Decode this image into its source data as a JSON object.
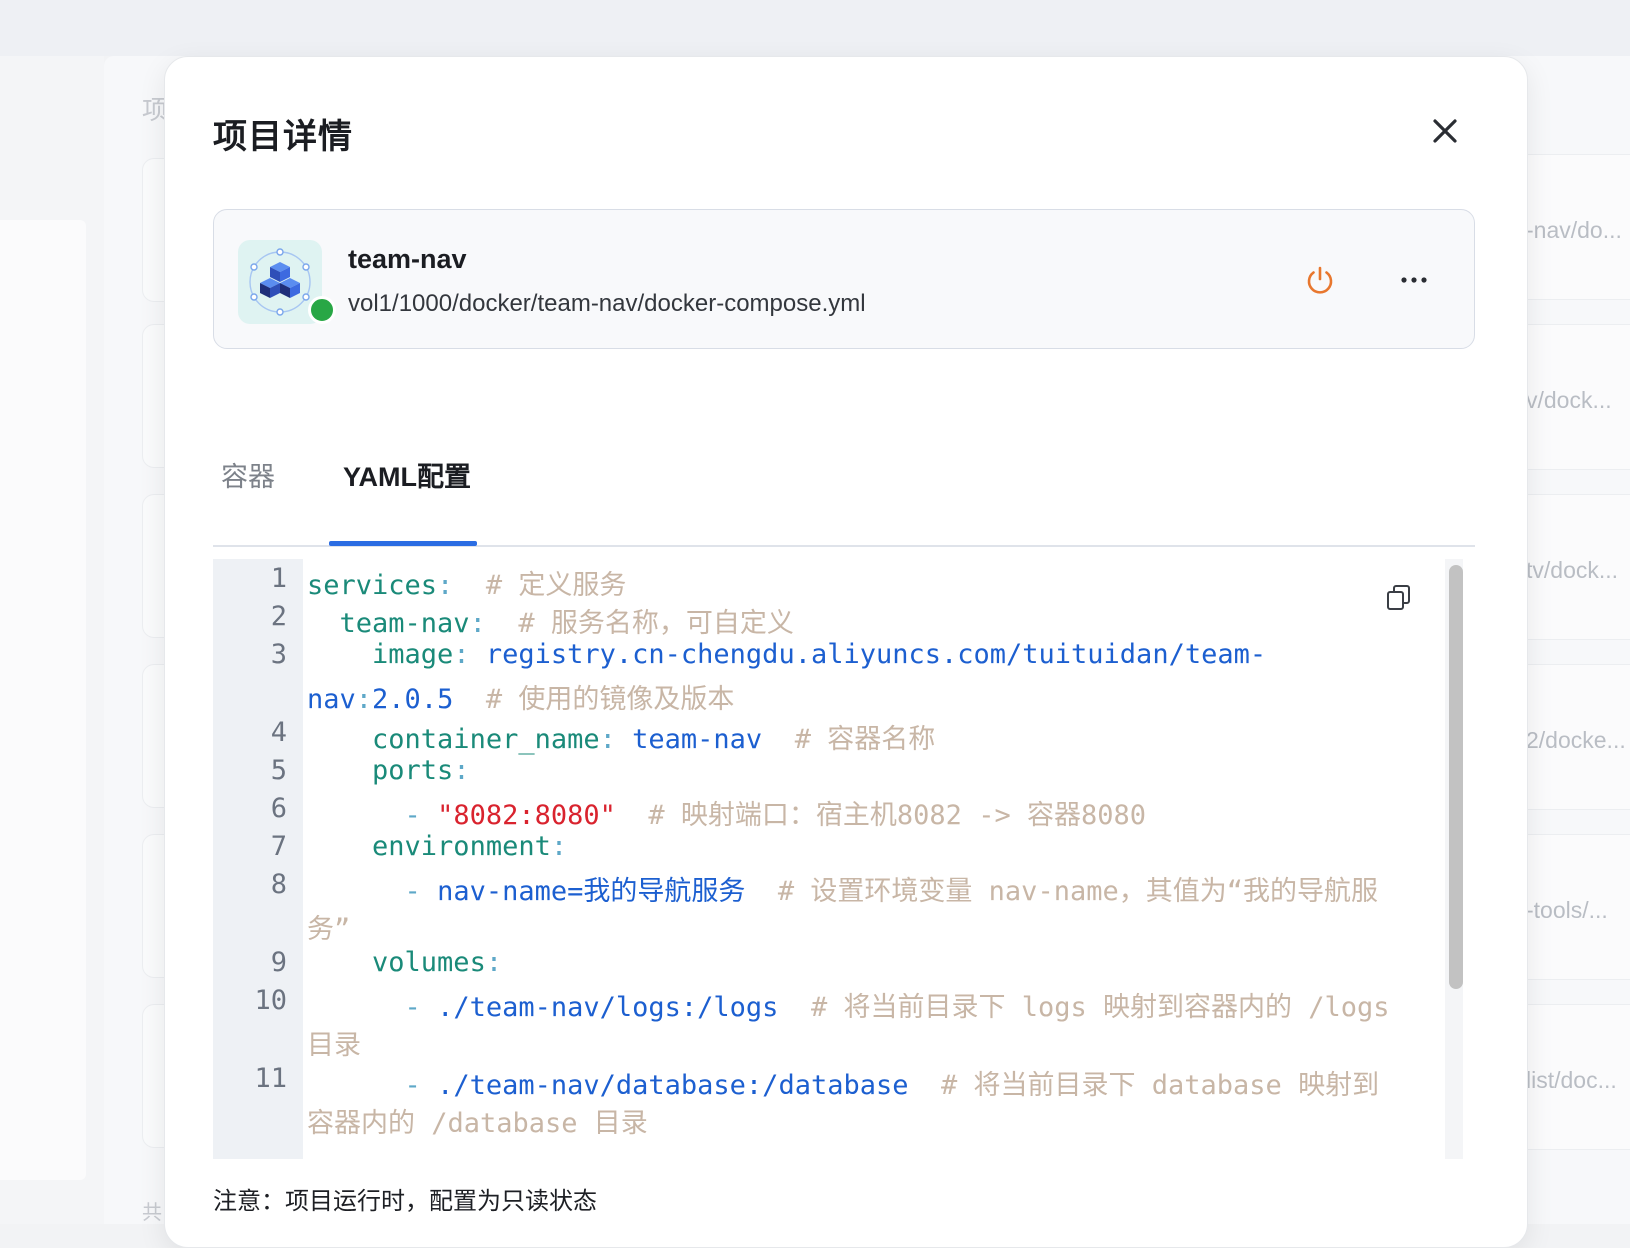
{
  "background": {
    "section_title": "项",
    "footer_text": "共",
    "right_rows": [
      "-nav/do...",
      "v/dock...",
      "tv/dock...",
      "2/docke...",
      "-tools/...",
      "list/doc..."
    ]
  },
  "modal": {
    "title": "项目详情",
    "close_icon": "close-icon"
  },
  "project": {
    "name": "team-nav",
    "path": "vol1/1000/docker/team-nav/docker-compose.yml",
    "status": "running",
    "status_color": "#28a745",
    "icon": "docker-cubes-icon",
    "power_icon": "power-icon",
    "power_color": "#e8772e",
    "more_icon": "more-icon"
  },
  "tabs": [
    {
      "label": "容器",
      "active": false
    },
    {
      "label": "YAML配置",
      "active": true
    }
  ],
  "editor": {
    "line_numbers": [
      "1",
      "2",
      "3",
      "4",
      "5",
      "6",
      "7",
      "8",
      "9",
      "10",
      "11"
    ],
    "lines": {
      "l1_key": "services",
      "l1_comment": "# 定义服务",
      "l2_key": "team-nav",
      "l2_comment": "# 服务名称，可自定义",
      "l3_key": "image",
      "l3_value_a": "registry.cn-chengdu.aliyuncs.com/tuituidan/team-",
      "l3_value_b": "nav",
      "l3_value_c": "2.0.5",
      "l3_comment": "# 使用的镜像及版本",
      "l4_key": "container_name",
      "l4_value": "team-nav",
      "l4_comment": "# 容器名称",
      "l5_key": "ports",
      "l6_value": "\"8082:8080\"",
      "l6_comment": "# 映射端口：宿主机8082 -> 容器8080",
      "l7_key": "environment",
      "l8_value": "nav-name=我的导航服务",
      "l8_comment_a": "# 设置环境变量 nav-name，其值为“我的导航服",
      "l8_comment_b": "务”",
      "l9_key": "volumes",
      "l10_value": "./team-nav/logs:/logs",
      "l10_comment_a": "# 将当前目录下 logs 映射到容器内的 /logs",
      "l10_comment_b": "目录",
      "l11_value": "./team-nav/database:/database",
      "l11_comment_a": "# 将当前目录下 database 映射到",
      "l11_comment_b": "容器内的 /database 目录"
    },
    "copy_icon": "copy-icon"
  },
  "note": "注意：项目运行时，配置为只读状态"
}
